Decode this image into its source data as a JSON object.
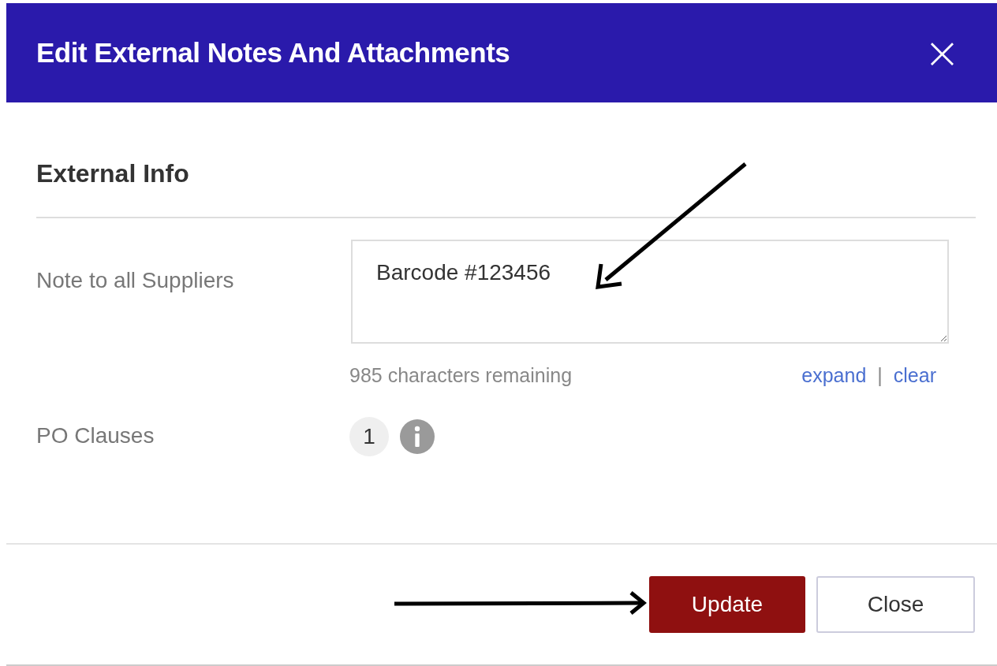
{
  "dialog": {
    "title": "Edit External Notes And Attachments",
    "close_icon": "×"
  },
  "section": {
    "title": "External Info"
  },
  "note_field": {
    "label": "Note to all Suppliers",
    "value": "Barcode #123456",
    "counter": "985 characters remaining",
    "links": [
      "expand",
      "clear"
    ],
    "separator": "|"
  },
  "po_clauses": {
    "label": "PO Clauses",
    "count": "1"
  },
  "buttons": [
    {
      "label": "Update",
      "kind": "primary"
    },
    {
      "label": "Close",
      "kind": "secondary"
    }
  ]
}
